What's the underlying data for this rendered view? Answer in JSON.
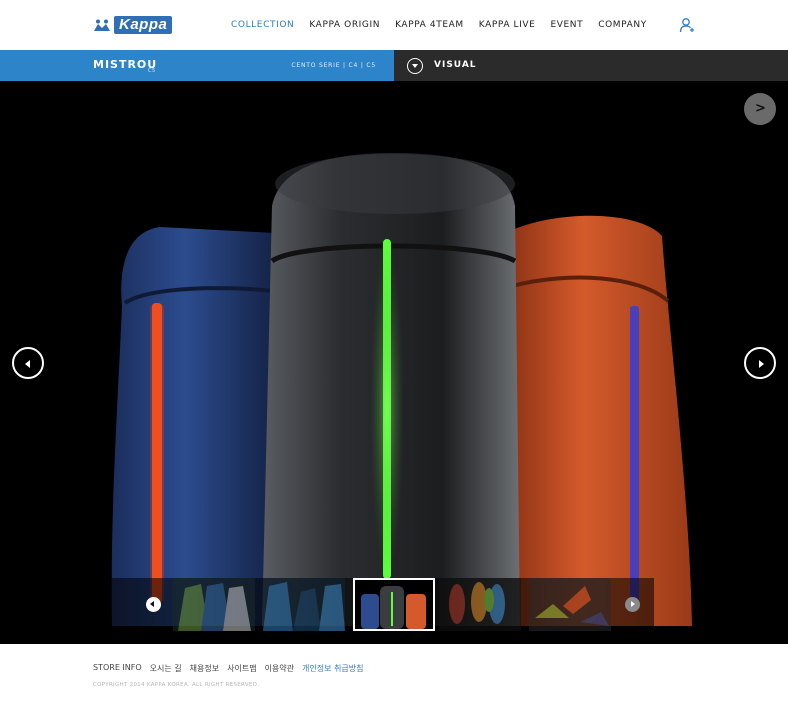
{
  "header": {
    "logo_text": "Kappa",
    "nav": [
      {
        "label": "COLLECTION",
        "active": true
      },
      {
        "label": "KAPPA ORIGIN",
        "active": false
      },
      {
        "label": "KAPPA 4TEAM",
        "active": false
      },
      {
        "label": "KAPPA LIVE",
        "active": false
      },
      {
        "label": "EVENT",
        "active": false
      },
      {
        "label": "COMPANY",
        "active": false
      }
    ],
    "user_icon": "user-add-icon"
  },
  "subbar": {
    "product_name": "MISTROU",
    "product_sub": "C5",
    "series": "CENTO SERIE | C4 | C5",
    "visual_label": "VISUAL",
    "left_color": "#2e84c9",
    "right_color": "#2b2b2b"
  },
  "stage": {
    "share_icon": "share-arrow-icon",
    "prev_icon": "arrow-left-icon",
    "next_icon": "arrow-right-icon",
    "bag_colors": [
      "#2a4a8a",
      "#3a3a3a",
      "#c4512a"
    ],
    "thumbnails": [
      {
        "name": "jackets-green-blue",
        "active": false
      },
      {
        "name": "jackets-blue",
        "active": false
      },
      {
        "name": "bags",
        "active": true
      },
      {
        "name": "shoes-mixed",
        "active": false
      },
      {
        "name": "shoes-orange",
        "active": false
      }
    ]
  },
  "footer": {
    "links": [
      {
        "label": "STORE INFO",
        "highlight": false
      },
      {
        "label": "오시는 길",
        "highlight": false
      },
      {
        "label": "채용정보",
        "highlight": false
      },
      {
        "label": "사이트맵",
        "highlight": false
      },
      {
        "label": "이용약관",
        "highlight": false
      },
      {
        "label": "개인정보 취급방침",
        "highlight": true
      }
    ],
    "copyright": "COPYRIGHT 2014 KAPPA KOREA. ALL RIGHT RESERVED."
  }
}
